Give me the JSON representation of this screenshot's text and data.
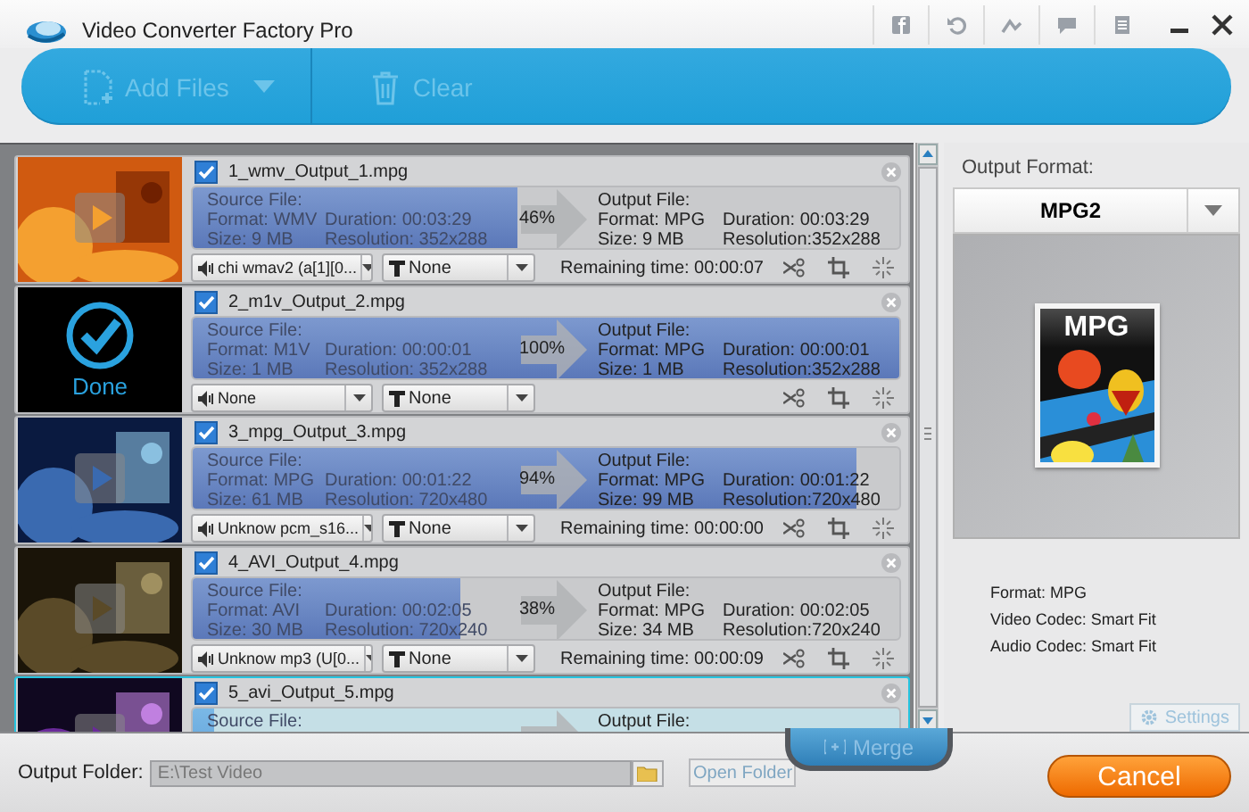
{
  "window": {
    "title": "Video Converter Factory Pro"
  },
  "toolbar": {
    "buttons": [
      {
        "kind": "add",
        "label": "Add Files",
        "disabled": true
      },
      {
        "kind": "clear",
        "label": "Clear",
        "disabled": true
      }
    ]
  },
  "tasks": [
    {
      "name": "1_wmv_Output_1.mpg",
      "checked": true,
      "selected": false,
      "level": 0.46,
      "percent": "46%",
      "source": {
        "label": "Source File:",
        "format": "Format: WMV",
        "duration": "Duration: 00:03:29",
        "size": "Size: 9 MB",
        "resolution": "Resolution: 352x288"
      },
      "output": {
        "label": "Output File:",
        "format": "Format: MPG",
        "duration": "Duration: 00:03:29",
        "size": "Size: 9 MB",
        "resolution": "Resolution:352x288"
      },
      "audio": "chi wmav2 (a[1][0...",
      "subtitle": "None",
      "remaining": "Remaining time: 00:00:07"
    },
    {
      "name": "2_m1v_Output_2.mpg",
      "checked": true,
      "selected": false,
      "thumbnail": {
        "kind": "done",
        "label": "Done"
      },
      "level": 1,
      "percent": "100%",
      "source": {
        "label": "Source File:",
        "format": "Format: M1V",
        "duration": "Duration: 00:00:01",
        "size": "Size: 1 MB",
        "resolution": "Resolution: 352x288"
      },
      "output": {
        "label": "Output File:",
        "format": "Format: MPG",
        "duration": "Duration: 00:00:01",
        "size": "Size: 1 MB",
        "resolution": "Resolution:352x288"
      },
      "audio": "None",
      "subtitle": "None"
    },
    {
      "name": "3_mpg_Output_3.mpg",
      "checked": true,
      "selected": false,
      "level": 0.94,
      "percent": "94%",
      "source": {
        "label": "Source File:",
        "format": "Format: MPG",
        "duration": "Duration: 00:01:22",
        "size": "Size: 61 MB",
        "resolution": "Resolution: 720x480"
      },
      "output": {
        "label": "Output File:",
        "format": "Format: MPG",
        "duration": "Duration: 00:01:22",
        "size": "Size: 99 MB",
        "resolution": "Resolution:720x480"
      },
      "audio": "Unknow pcm_s16...",
      "subtitle": "None",
      "remaining": "Remaining time: 00:00:00"
    },
    {
      "name": "4_AVI_Output_4.mpg",
      "checked": true,
      "selected": false,
      "level": 0.38,
      "percent": "38%",
      "source": {
        "label": "Source File:",
        "format": "Format: AVI",
        "duration": "Duration: 00:02:05",
        "size": "Size: 30 MB",
        "resolution": "Resolution: 720x240"
      },
      "output": {
        "label": "Output File:",
        "format": "Format: MPG",
        "duration": "Duration: 00:02:05",
        "size": "Size: 34 MB",
        "resolution": "Resolution:720x240"
      },
      "audio": "Unknow mp3 (U[0...",
      "subtitle": "None",
      "remaining": "Remaining time: 00:00:09"
    },
    {
      "name": "5_avi_Output_5.mpg",
      "checked": true,
      "selected": true,
      "level": 0.03,
      "source": {
        "label": "Source File:"
      },
      "output": {
        "label": "Output File:"
      }
    }
  ],
  "output_panel": {
    "label": "Output Format:",
    "format": "MPG2",
    "preview_label": "MPG",
    "details": [
      "Format: MPG",
      "Video Codec: Smart Fit",
      "Audio Codec: Smart Fit"
    ],
    "settings": {
      "label": "Settings",
      "disabled": true
    }
  },
  "bottom": {
    "label": "Output Folder:",
    "value": "E:\\Test Video",
    "open_folder": {
      "label": "Open Folder",
      "disabled": true
    },
    "merge": {
      "label": "Merge",
      "disabled": true
    },
    "cancel": "Cancel"
  }
}
